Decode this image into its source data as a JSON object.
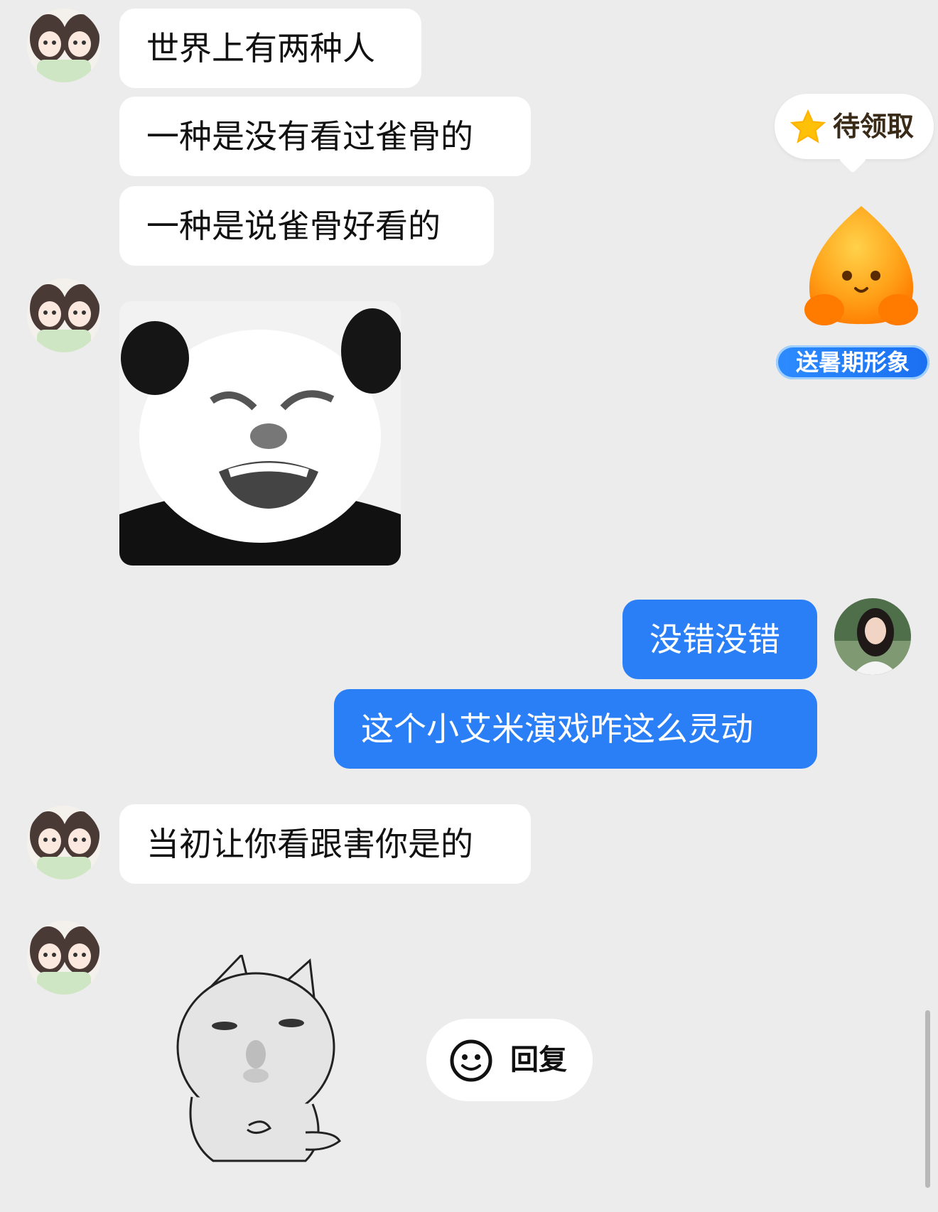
{
  "messages": {
    "m1": "世界上有两种人",
    "m2": "一种是没有看过雀骨的",
    "m3": "一种是说雀骨好看的",
    "m4": "没错没错",
    "m5": "这个小艾米演戏咋这么灵动",
    "m6": "当初让你看跟害你是的"
  },
  "reward": {
    "label": "待领取"
  },
  "summer": {
    "label": "送暑期形象"
  },
  "reply": {
    "label": "回复"
  },
  "colors": {
    "outgoing_bubble": "#2b7ff6",
    "incoming_bubble": "#ffffff",
    "background": "#ececec"
  },
  "icons": [
    "star-icon",
    "smiley-icon",
    "mascot-icon",
    "panda-meme-sticker",
    "cat-meme-sticker"
  ]
}
